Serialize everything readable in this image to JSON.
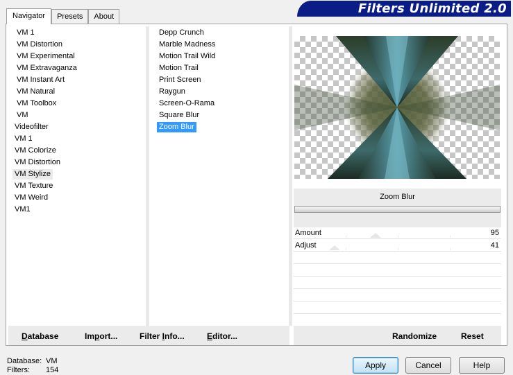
{
  "tabs": [
    {
      "label": "Navigator",
      "active": true
    },
    {
      "label": "Presets",
      "active": false
    },
    {
      "label": "About",
      "active": false
    }
  ],
  "banner_title": "Filters Unlimited 2.0",
  "categories": [
    "VM 1",
    "VM Distortion",
    "VM Experimental",
    "VM Extravaganza",
    "VM Instant Art",
    "VM Natural",
    "VM Toolbox",
    "VM",
    "Videofilter",
    "VM 1",
    "VM Colorize",
    "VM Distortion",
    "VM Stylize",
    "VM Texture",
    "VM Weird",
    "VM1"
  ],
  "selected_category": "VM Stylize",
  "filters": [
    "Depp Crunch",
    "Marble Madness",
    "Motion Trail Wild",
    "Motion Trail",
    "Print Screen",
    "Raygun",
    "Screen-O-Rama",
    "Square Blur",
    "Zoom Blur"
  ],
  "selected_filter": "Zoom Blur",
  "preview": {
    "filter_name": "Zoom Blur",
    "progress_fraction": 1.0
  },
  "controls": [
    {
      "label": "Amount",
      "value": "95",
      "max": 255
    },
    {
      "label": "Adjust",
      "value": "41",
      "max": 255
    }
  ],
  "bottom_left": {
    "database": "Database",
    "import": "Import...",
    "filter_info": "Filter Info...",
    "editor": "Editor..."
  },
  "bottom_right": {
    "randomize": "Randomize",
    "reset": "Reset"
  },
  "status": {
    "database_label": "Database:",
    "database_value": "VM",
    "filters_label": "Filters:",
    "filters_value": "154"
  },
  "buttons": {
    "apply": "Apply",
    "cancel": "Cancel",
    "help": "Help"
  },
  "colors": {
    "banner": "#0a1c85",
    "selection": "#3399ff"
  }
}
